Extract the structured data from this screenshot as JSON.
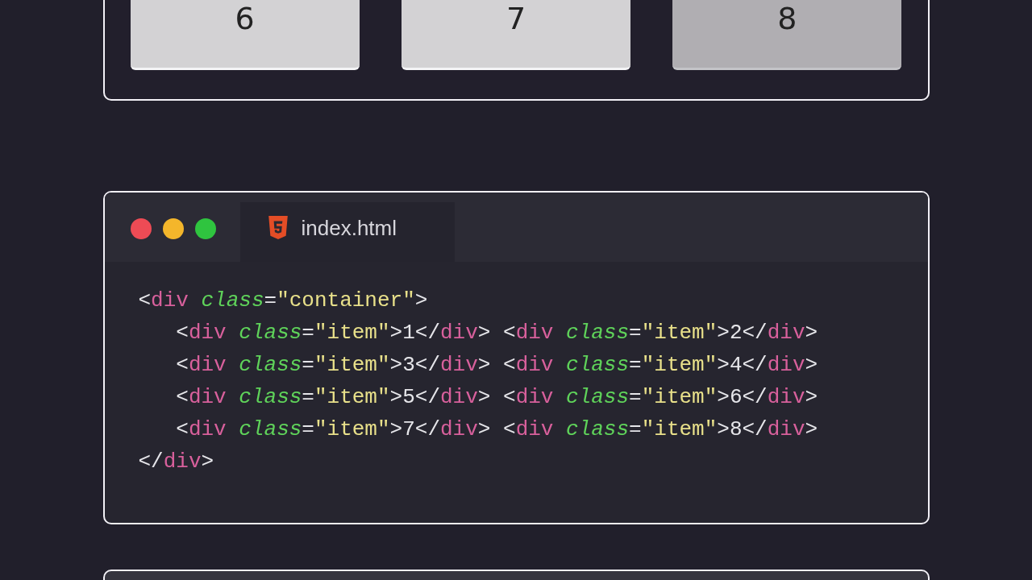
{
  "grid_preview": {
    "items": [
      {
        "label": "6",
        "selected": false
      },
      {
        "label": "7",
        "selected": false
      },
      {
        "label": "8",
        "selected": true
      }
    ]
  },
  "editor": {
    "tab": {
      "filename": "index.html",
      "selected": true
    },
    "code": [
      {
        "tokens": [
          {
            "kind": "punct",
            "text": "<"
          },
          {
            "kind": "tag",
            "text": "div"
          },
          {
            "kind": "attr",
            "text": " class"
          },
          {
            "kind": "punct",
            "text": "="
          },
          {
            "kind": "string",
            "text": "\"container\""
          },
          {
            "kind": "punct",
            "text": ">"
          }
        ],
        "children": [
          {
            "tokens": [
              {
                "kind": "punct",
                "text": "<"
              },
              {
                "kind": "tag",
                "text": "div"
              },
              {
                "kind": "attr",
                "text": " class"
              },
              {
                "kind": "punct",
                "text": "="
              },
              {
                "kind": "string",
                "text": "\"item\""
              },
              {
                "kind": "punct",
                "text": ">1</"
              },
              {
                "kind": "tag",
                "text": "div"
              },
              {
                "kind": "punct",
                "text": "> <"
              },
              {
                "kind": "tag",
                "text": "div"
              },
              {
                "kind": "attr",
                "text": " class"
              },
              {
                "kind": "punct",
                "text": "="
              },
              {
                "kind": "string",
                "text": "\"item\""
              },
              {
                "kind": "punct",
                "text": ">2</"
              },
              {
                "kind": "tag",
                "text": "div"
              },
              {
                "kind": "punct",
                "text": ">"
              }
            ]
          },
          {
            "tokens": [
              {
                "kind": "punct",
                "text": "<"
              },
              {
                "kind": "tag",
                "text": "div"
              },
              {
                "kind": "attr",
                "text": " class"
              },
              {
                "kind": "punct",
                "text": "="
              },
              {
                "kind": "string",
                "text": "\"item\""
              },
              {
                "kind": "punct",
                "text": ">3</"
              },
              {
                "kind": "tag",
                "text": "div"
              },
              {
                "kind": "punct",
                "text": "> <"
              },
              {
                "kind": "tag",
                "text": "div"
              },
              {
                "kind": "attr",
                "text": " class"
              },
              {
                "kind": "punct",
                "text": "="
              },
              {
                "kind": "string",
                "text": "\"item\""
              },
              {
                "kind": "punct",
                "text": ">4</"
              },
              {
                "kind": "tag",
                "text": "div"
              },
              {
                "kind": "punct",
                "text": ">"
              }
            ]
          },
          {
            "tokens": [
              {
                "kind": "punct",
                "text": "<"
              },
              {
                "kind": "tag",
                "text": "div"
              },
              {
                "kind": "attr",
                "text": " class"
              },
              {
                "kind": "punct",
                "text": "="
              },
              {
                "kind": "string",
                "text": "\"item\""
              },
              {
                "kind": "punct",
                "text": ">5</"
              },
              {
                "kind": "tag",
                "text": "div"
              },
              {
                "kind": "punct",
                "text": "> <"
              },
              {
                "kind": "tag",
                "text": "div"
              },
              {
                "kind": "attr",
                "text": " class"
              },
              {
                "kind": "punct",
                "text": "="
              },
              {
                "kind": "string",
                "text": "\"item\""
              },
              {
                "kind": "punct",
                "text": ">6</"
              },
              {
                "kind": "tag",
                "text": "div"
              },
              {
                "kind": "punct",
                "text": ">"
              }
            ]
          },
          {
            "tokens": [
              {
                "kind": "punct",
                "text": "<"
              },
              {
                "kind": "tag",
                "text": "div"
              },
              {
                "kind": "attr",
                "text": " class"
              },
              {
                "kind": "punct",
                "text": "="
              },
              {
                "kind": "string",
                "text": "\"item\""
              },
              {
                "kind": "punct",
                "text": ">7</"
              },
              {
                "kind": "tag",
                "text": "div"
              },
              {
                "kind": "punct",
                "text": "> <"
              },
              {
                "kind": "tag",
                "text": "div"
              },
              {
                "kind": "attr",
                "text": " class"
              },
              {
                "kind": "punct",
                "text": "="
              },
              {
                "kind": "string",
                "text": "\"item\""
              },
              {
                "kind": "punct",
                "text": ">8</"
              },
              {
                "kind": "tag",
                "text": "div"
              },
              {
                "kind": "punct",
                "text": ">"
              }
            ]
          }
        ]
      },
      {
        "tokens": [
          {
            "kind": "punct",
            "text": "</"
          },
          {
            "kind": "tag",
            "text": "div"
          },
          {
            "kind": "punct",
            "text": ">"
          }
        ]
      }
    ]
  }
}
